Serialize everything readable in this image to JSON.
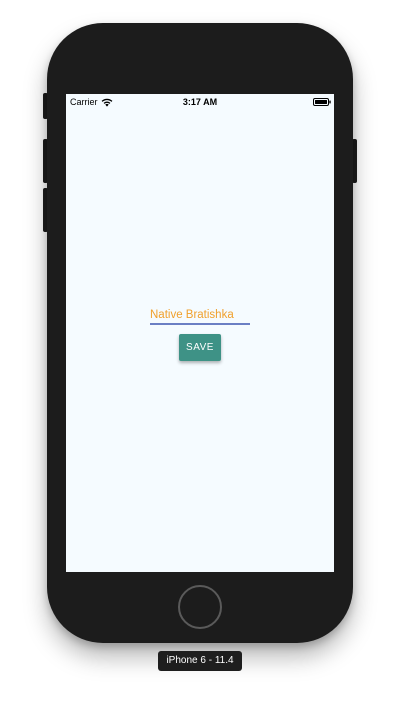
{
  "status_bar": {
    "carrier": "Carrier",
    "time": "3:17 AM",
    "wifi_icon": "wifi-icon",
    "battery_icon": "battery-full-icon"
  },
  "form": {
    "input_value": "Native Bratishka",
    "save_label": "SAVE"
  },
  "simulator": {
    "device_label": "iPhone 6 - 11.4",
    "home_button_icon": "home-button"
  },
  "colors": {
    "screen_background": "#f5fbff",
    "input_text": "#f0a02c",
    "input_underline": "#6b7fc4",
    "button_background": "#3e9286",
    "button_text": "#ffffff",
    "device_body": "#1c1c1c"
  }
}
